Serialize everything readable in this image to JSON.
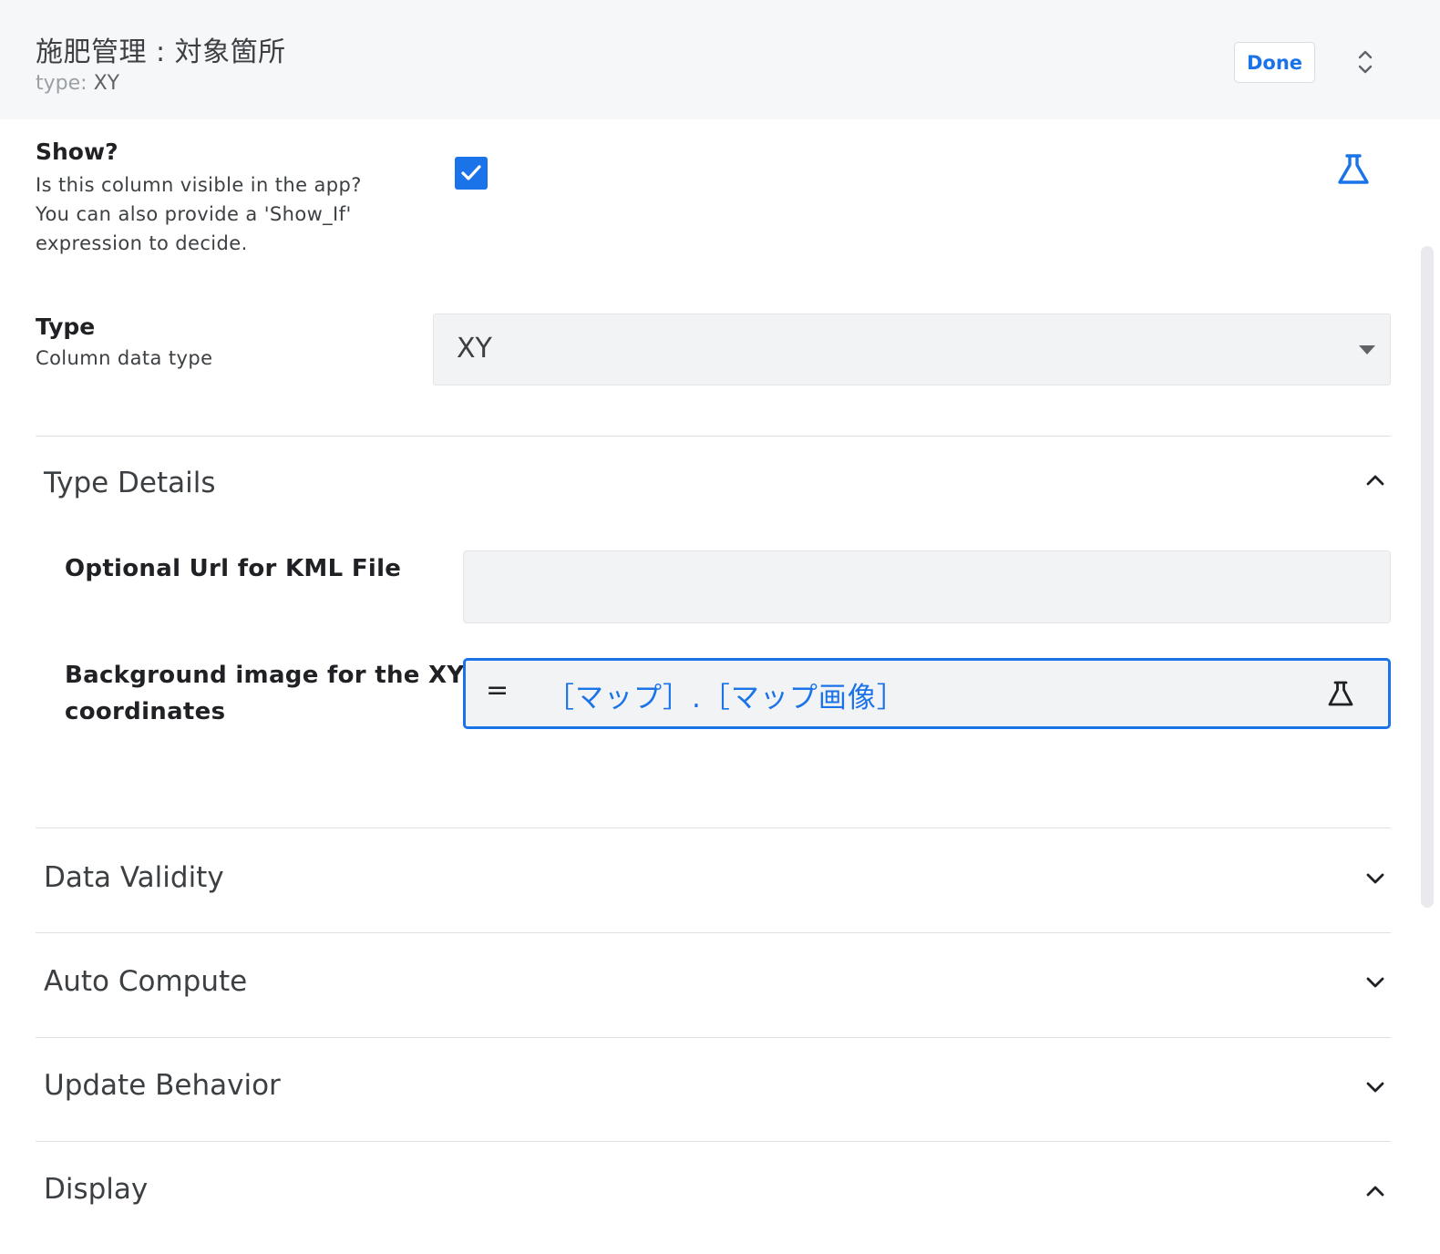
{
  "header": {
    "title": "施肥管理 : 対象箇所",
    "subtitle_label": "type:",
    "subtitle_value": "XY",
    "done_label": "Done"
  },
  "show": {
    "label": "Show?",
    "help_lines": [
      "Is this column visible in the app?",
      "You can also provide a 'Show_If'",
      "expression to decide."
    ],
    "checked": true
  },
  "type": {
    "label": "Type",
    "help": "Column data type",
    "selected": "XY"
  },
  "type_details": {
    "title": "Type Details",
    "kml_label": "Optional Url for KML File",
    "kml_value": "",
    "bg_label_lines": [
      "Background image for the XY",
      "coordinates"
    ],
    "bg_eq": "=",
    "bg_expression": "［マップ］.［マップ画像］"
  },
  "sections": [
    {
      "title": "Data Validity",
      "expanded": false
    },
    {
      "title": "Auto Compute",
      "expanded": false
    },
    {
      "title": "Update Behavior",
      "expanded": false
    },
    {
      "title": "Display",
      "expanded": true
    }
  ],
  "colors": {
    "accent": "#1a73e8",
    "header_bg": "#f6f7f9",
    "input_bg": "#f1f3f4"
  },
  "icons": {
    "expand": "unfold-more-icon",
    "test": "flask-icon",
    "check": "checkmark-icon",
    "expanded": "chevron-up-icon",
    "collapsed": "chevron-down-icon"
  }
}
